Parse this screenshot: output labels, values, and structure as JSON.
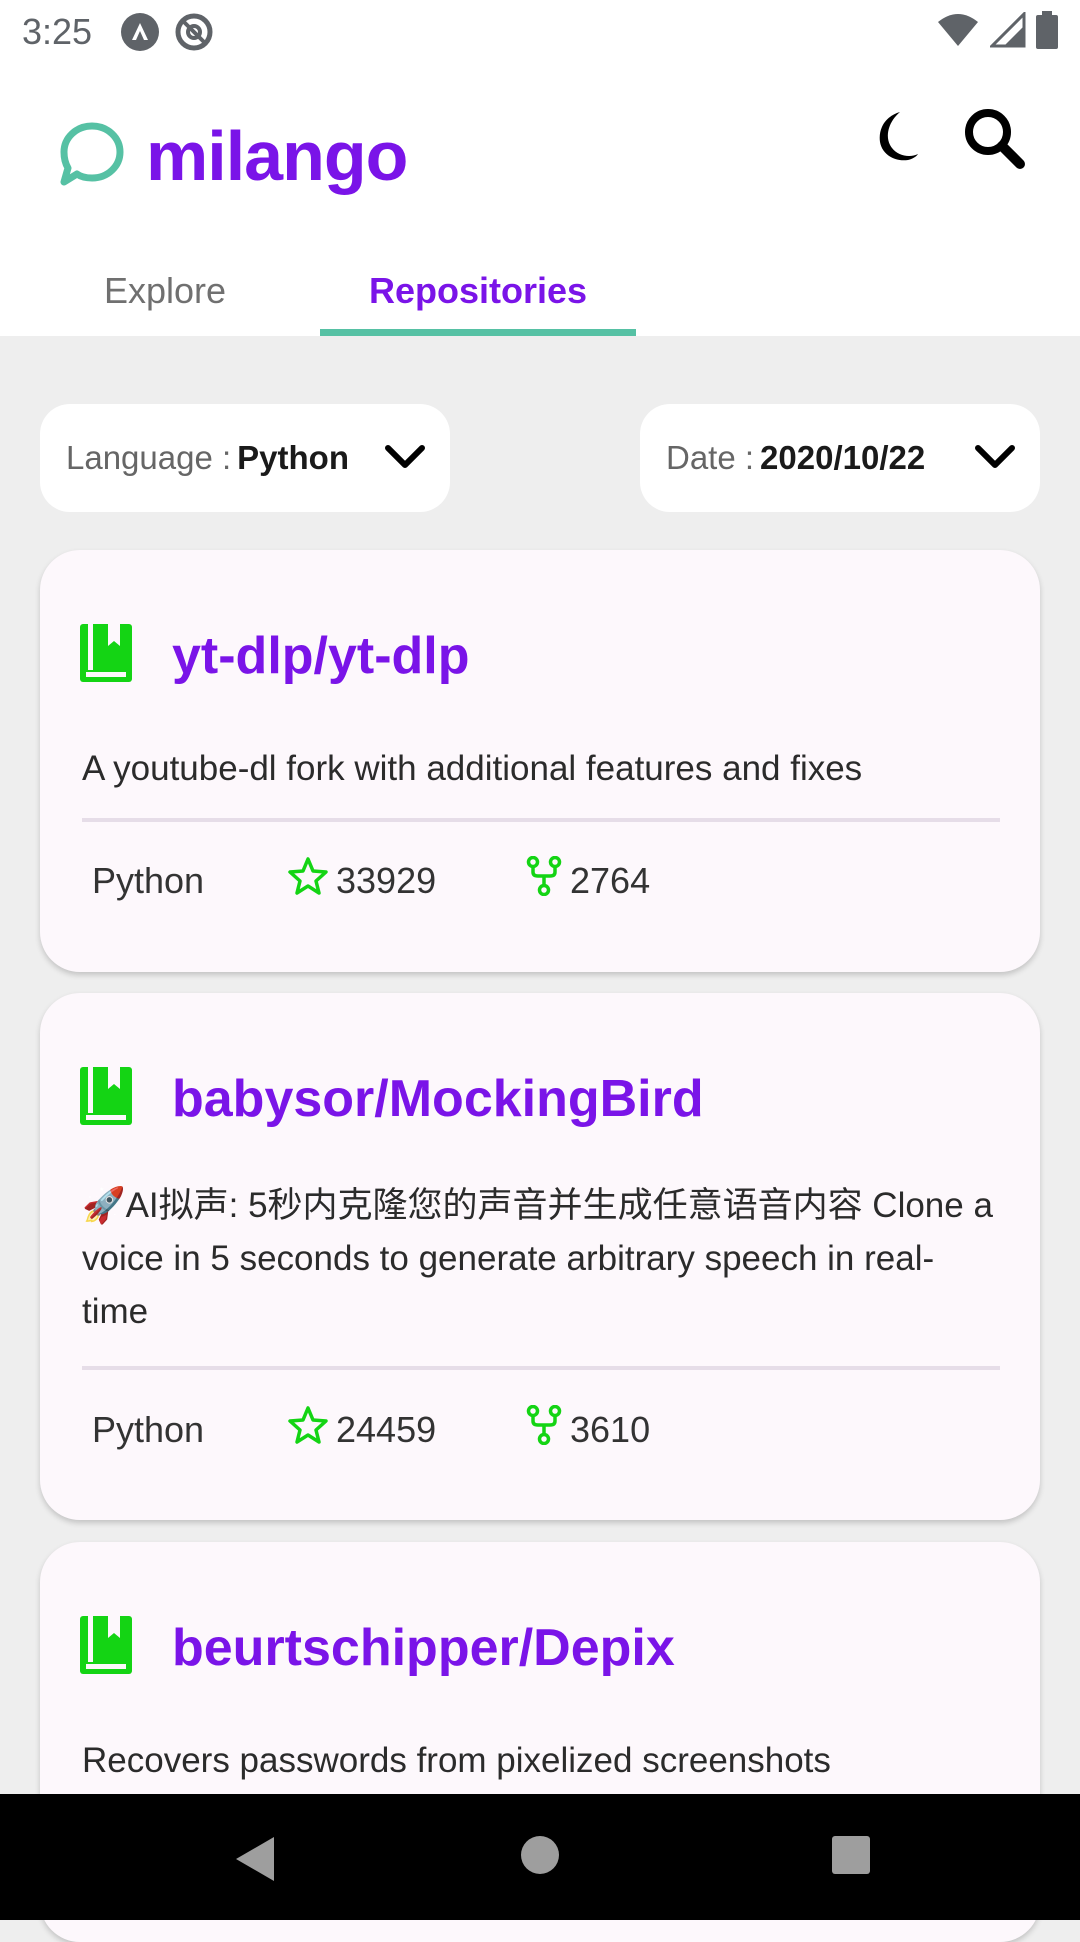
{
  "status_bar": {
    "time": "3:25",
    "icons": [
      "notification-a-icon",
      "notification-at-icon",
      "wifi-icon",
      "signal-icon",
      "battery-icon"
    ]
  },
  "header": {
    "app_name": "milango",
    "logo_icon": "chat-bubble-icon",
    "actions": [
      "dark-mode-icon",
      "search-icon"
    ]
  },
  "tabs": [
    {
      "label": "Explore",
      "active": false
    },
    {
      "label": "Repositories",
      "active": true
    }
  ],
  "filters": {
    "language": {
      "label": "Language :",
      "value": "Python"
    },
    "date": {
      "label": "Date :",
      "value": "2020/10/22"
    }
  },
  "repos": [
    {
      "name": "yt-dlp/yt-dlp",
      "description": "A youtube-dl fork with additional features and fixes",
      "language": "Python",
      "stars": "33929",
      "forks": "2764"
    },
    {
      "name": "babysor/MockingBird",
      "description": "🚀AI拟声: 5秒内克隆您的声音并生成任意语音内容 Clone a voice in 5 seconds to generate arbitrary speech in real-time",
      "language": "Python",
      "stars": "24459",
      "forks": "3610"
    },
    {
      "name": "beurtschipper/Depix",
      "description": "Recovers passwords from pixelized screenshots"
    }
  ],
  "colors": {
    "accent": "#7a14e8",
    "teal": "#56c1a4",
    "repo_icon": "#14d414"
  }
}
